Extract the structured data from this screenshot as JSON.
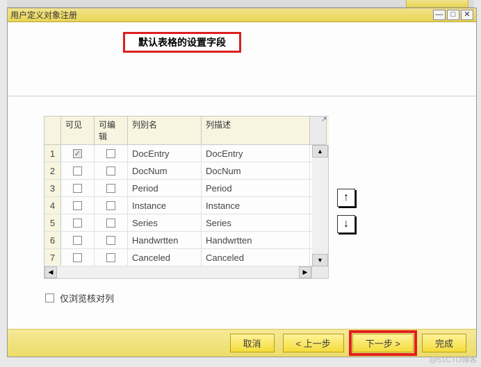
{
  "window": {
    "title": "用户定义对象注册"
  },
  "callout": "默认表格的设置字段",
  "columns": {
    "visible": "可见",
    "editable": "可编辑",
    "alias": "列别名",
    "desc": "列描述"
  },
  "rows": [
    {
      "n": "1",
      "vis_on": true,
      "vis_dis": true,
      "alias": "DocEntry",
      "desc": "DocEntry"
    },
    {
      "n": "2",
      "vis_on": false,
      "vis_dis": false,
      "alias": "DocNum",
      "desc": "DocNum"
    },
    {
      "n": "3",
      "vis_on": false,
      "vis_dis": false,
      "alias": "Period",
      "desc": "Period"
    },
    {
      "n": "4",
      "vis_on": false,
      "vis_dis": false,
      "alias": "Instance",
      "desc": "Instance"
    },
    {
      "n": "5",
      "vis_on": false,
      "vis_dis": false,
      "alias": "Series",
      "desc": "Series"
    },
    {
      "n": "6",
      "vis_on": false,
      "vis_dis": false,
      "alias": "Handwrtten",
      "desc": "Handwrtten"
    },
    {
      "n": "7",
      "vis_on": false,
      "vis_dis": false,
      "alias": "Canceled",
      "desc": "Canceled"
    }
  ],
  "option": {
    "label": "仅浏览核对列"
  },
  "buttons": {
    "cancel": "取消",
    "prev": "< 上一步",
    "next": "下一步 >",
    "finish": "完成"
  },
  "arrows": {
    "up": "↑",
    "down": "↓"
  },
  "watermark": "@51CTO博客"
}
